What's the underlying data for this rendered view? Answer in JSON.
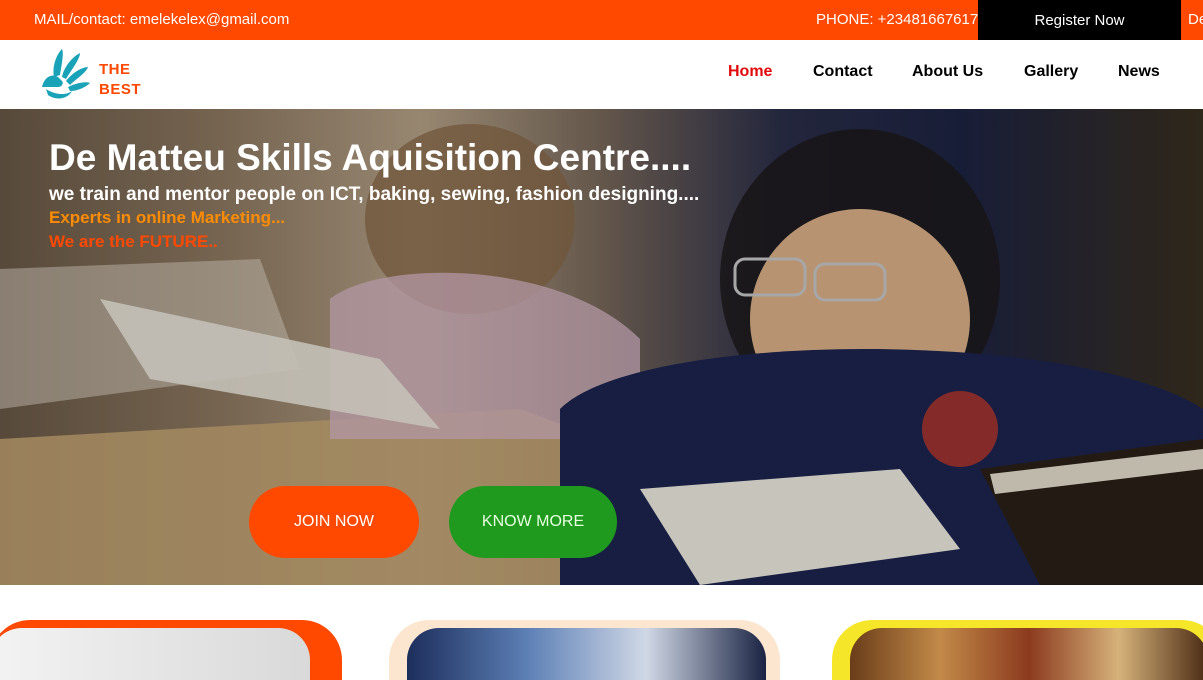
{
  "topbar": {
    "mail": "MAIL/contact: emelekelex@gmail.com",
    "phone": "PHONE: +23481667617",
    "register": "Register Now",
    "extra": "De"
  },
  "logo": {
    "line1": "THE",
    "line2": "BEST",
    "icon": "hand-icon"
  },
  "nav": [
    {
      "label": "Home",
      "active": true
    },
    {
      "label": "Contact",
      "active": false
    },
    {
      "label": "About Us",
      "active": false
    },
    {
      "label": "Gallery",
      "active": false
    },
    {
      "label": "News",
      "active": false
    }
  ],
  "hero": {
    "title": "De Matteu Skills Aquisition Centre....",
    "subtitle": "we train and mentor people on ICT, baking, sewing, fashion designing....",
    "line2": "Experts in online Marketing...",
    "line3": "We are the FUTURE..",
    "join_label": "JOIN NOW",
    "know_label": "KNOW MORE"
  },
  "colors": {
    "accent": "#ff4800",
    "nav_active": "#e10b0b",
    "green": "#1f9a1f",
    "orange_text": "#ff8c00"
  }
}
